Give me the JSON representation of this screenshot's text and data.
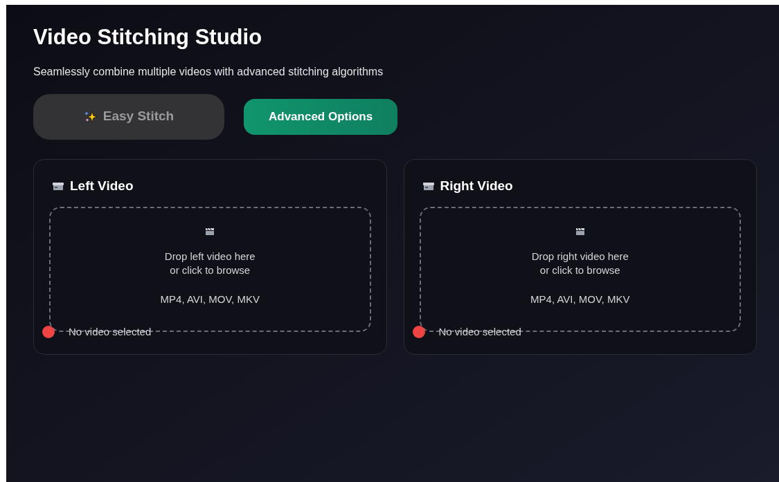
{
  "header": {
    "title": "Video Stitching Studio",
    "subtitle": "Seamlessly combine multiple videos with advanced stitching algorithms"
  },
  "tabs": [
    {
      "label": "Easy Stitch",
      "selected": false
    },
    {
      "label": "Advanced Options",
      "selected": true
    }
  ],
  "panels": [
    {
      "title": "Left Video",
      "drop_text": "Drop left video here",
      "browse_text": "or click to browse",
      "formats": "MP4, AVI, MOV, MKV",
      "status": {
        "text": "No video selected",
        "color": "#ef4444"
      }
    },
    {
      "title": "Right Video",
      "drop_text": "Drop right video here",
      "browse_text": "or click to browse",
      "formats": "MP4, AVI, MOV, MKV",
      "status": {
        "text": "No video selected",
        "color": "#ef4444"
      }
    }
  ]
}
